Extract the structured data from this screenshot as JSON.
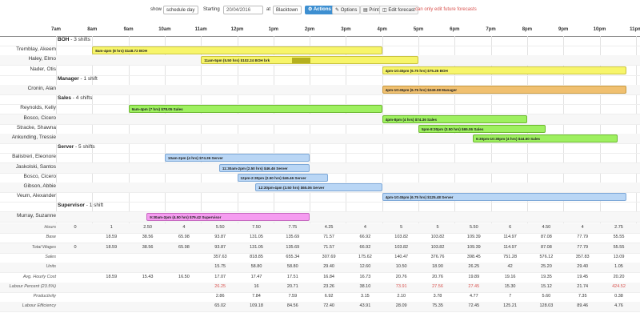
{
  "toolbar": {
    "show_label": "show",
    "view_select": "schedule day",
    "starting_label": "Starting",
    "date_value": "20/04/2016",
    "at_label": "at",
    "location_select": "Blacktown",
    "actions_label": "Actions",
    "options_label": "Options",
    "print_label": "Print",
    "edit_forecast_label": "Edit forecast",
    "warning": "can only edit future forecasts"
  },
  "hours": [
    "7am",
    "8am",
    "9am",
    "10am",
    "11am",
    "12pm",
    "1pm",
    "2pm",
    "3pm",
    "4pm",
    "5pm",
    "6pm",
    "7pm",
    "8pm",
    "9pm",
    "10pm",
    "11pm"
  ],
  "groups": [
    {
      "name": "BOH",
      "count": "- 3 shifts",
      "rows": [
        {
          "name": "Tremblay, Akeem",
          "shift": {
            "label": "8am-4pm (8 hrs) $148.72 BOH",
            "start": 8,
            "end": 16,
            "color": "yellow"
          }
        },
        {
          "name": "Haley, Elmo",
          "shift": {
            "label": "11am-5pm (5.50 hrs) $102.24 BOH brk",
            "start": 11,
            "end": 17,
            "color": "yellow",
            "brk": [
              13.5,
              14
            ]
          }
        },
        {
          "name": "Nader, Otis",
          "shift": {
            "label": "4pm-10:45pm (6.75 hrs) $75.26 BOH",
            "start": 16,
            "end": 22.75,
            "color": "yellow"
          }
        }
      ]
    },
    {
      "name": "Manager",
      "count": "- 1 shift",
      "rows": [
        {
          "name": "Cronin, Alan",
          "shift": {
            "label": "4pm-10:45pm (6.75 hrs) $249.08 Manager",
            "start": 16,
            "end": 22.75,
            "color": "orange"
          }
        }
      ]
    },
    {
      "name": "Sales",
      "count": "- 4 shifts",
      "rows": [
        {
          "name": "Reynolds, Kelly",
          "shift": {
            "label": "9am-4pm (7 hrs) $78.05 Sales",
            "start": 9,
            "end": 16,
            "color": "green"
          }
        },
        {
          "name": "Bosco, Cicero",
          "shift": {
            "label": "4pm-8pm (4 hrs) $74.36 Sales",
            "start": 16,
            "end": 20,
            "color": "green"
          }
        },
        {
          "name": "Stracke, Shawna",
          "shift": {
            "label": "5pm-8:30pm (3.50 hrs) $65.06 Sales",
            "start": 17,
            "end": 20.5,
            "color": "green"
          }
        },
        {
          "name": "Ankunding, Tressie",
          "shift": {
            "label": "6:30pm-10:30pm (4 hrs) $44.60 Sales",
            "start": 18.5,
            "end": 22.5,
            "color": "green"
          }
        }
      ]
    },
    {
      "name": "Server",
      "count": "- 5 shifts",
      "rows": [
        {
          "name": "Balistreri, Eleonore",
          "shift": {
            "label": "10am-2pm (4 hrs) $74.36 Server",
            "start": 10,
            "end": 14,
            "color": "blue"
          }
        },
        {
          "name": "Jaskolski, Santos",
          "shift": {
            "label": "11:30am-2pm (2.50 hrs) $46.46 Server",
            "start": 11.5,
            "end": 14,
            "color": "blue"
          }
        },
        {
          "name": "Bosco, Cicero",
          "shift": {
            "label": "12pm-2:30pm (2.50 hrs) $46.46 Server",
            "start": 12,
            "end": 14.5,
            "color": "blue"
          }
        },
        {
          "name": "Gibson, Abbie",
          "shift": {
            "label": "12:30pm-4pm (3.50 hrs) $65.06 Server",
            "start": 12.5,
            "end": 16,
            "color": "blue"
          }
        },
        {
          "name": "Veum, Alexander",
          "shift": {
            "label": "4pm-10:45pm (6.75 hrs) $125.48 Server",
            "start": 16,
            "end": 22.75,
            "color": "blue"
          }
        }
      ]
    },
    {
      "name": "Supervisor",
      "count": "- 1 shift",
      "rows": [
        {
          "name": "Murray, Suzanne",
          "shift": {
            "label": "9:30am-2pm (4.50 hrs) $79.42 Supervisor",
            "start": 9.5,
            "end": 14,
            "color": "pink"
          }
        }
      ]
    }
  ],
  "stats": [
    {
      "label": "Hours",
      "values": [
        "0",
        "1",
        "2.50",
        "4",
        "5.50",
        "7.50",
        "7.75",
        "4.25",
        "4",
        "5",
        "5",
        "5.50",
        "6",
        "4.50",
        "4",
        "2.75"
      ]
    },
    {
      "label": "Base",
      "values": [
        "",
        "18.59",
        "38.56",
        "65.98",
        "93.87",
        "131.05",
        "135.69",
        "71.57",
        "66.92",
        "103.82",
        "103.82",
        "109.39",
        "114.97",
        "87.08",
        "77.79",
        "55.55"
      ]
    },
    {
      "label": "Total Wages",
      "values": [
        "0",
        "18.59",
        "38.56",
        "65.98",
        "93.87",
        "131.05",
        "135.69",
        "71.57",
        "66.92",
        "103.82",
        "103.82",
        "109.39",
        "114.97",
        "87.08",
        "77.79",
        "55.55"
      ]
    },
    {
      "label": "Sales",
      "values": [
        "",
        "",
        "",
        "",
        "357.63",
        "818.85",
        "655.34",
        "307.69",
        "175.62",
        "140.47",
        "376.76",
        "398.45",
        "751.28",
        "576.12",
        "357.83",
        "13.09"
      ]
    },
    {
      "label": "Units",
      "values": [
        "",
        "",
        "",
        "",
        "15.75",
        "58.80",
        "58.80",
        "29.40",
        "12.60",
        "10.50",
        "18.90",
        "26.25",
        "42",
        "25.20",
        "29.40",
        "1.05"
      ]
    },
    {
      "label": "Avg. Hourly Cost",
      "values": [
        "",
        "18.59",
        "15.43",
        "16.50",
        "17.07",
        "17.47",
        "17.51",
        "16.84",
        "16.73",
        "20.76",
        "20.76",
        "19.89",
        "19.16",
        "19.35",
        "19.45",
        "20.20"
      ]
    },
    {
      "label": "Labour Percent (23.5%)",
      "values": [
        "",
        "",
        "",
        "",
        "26.25",
        "16",
        "20.71",
        "23.26",
        "38.10",
        "73.91",
        "27.56",
        "27.45",
        "15.30",
        "15.12",
        "21.74",
        "424.52"
      ],
      "red": [
        4,
        9,
        10,
        11,
        15
      ]
    },
    {
      "label": "Productivity",
      "values": [
        "",
        "",
        "",
        "",
        "2.86",
        "7.84",
        "7.59",
        "6.92",
        "3.15",
        "2.10",
        "3.78",
        "4.77",
        "7",
        "5.60",
        "7.35",
        "0.38"
      ]
    },
    {
      "label": "Labour Efficiency",
      "values": [
        "",
        "",
        "",
        "",
        "65.02",
        "109.18",
        "84.56",
        "72.40",
        "43.91",
        "28.09",
        "75.35",
        "72.45",
        "125.21",
        "128.03",
        "89.46",
        "4.76"
      ]
    }
  ],
  "colors": {
    "yellow": "#f7f56a",
    "orange": "#f0c070",
    "green": "#9ef060",
    "blue": "#b9d6f5",
    "pink": "#f59cf0",
    "accent": "#3d8fd1",
    "warning": "#d9534f"
  }
}
